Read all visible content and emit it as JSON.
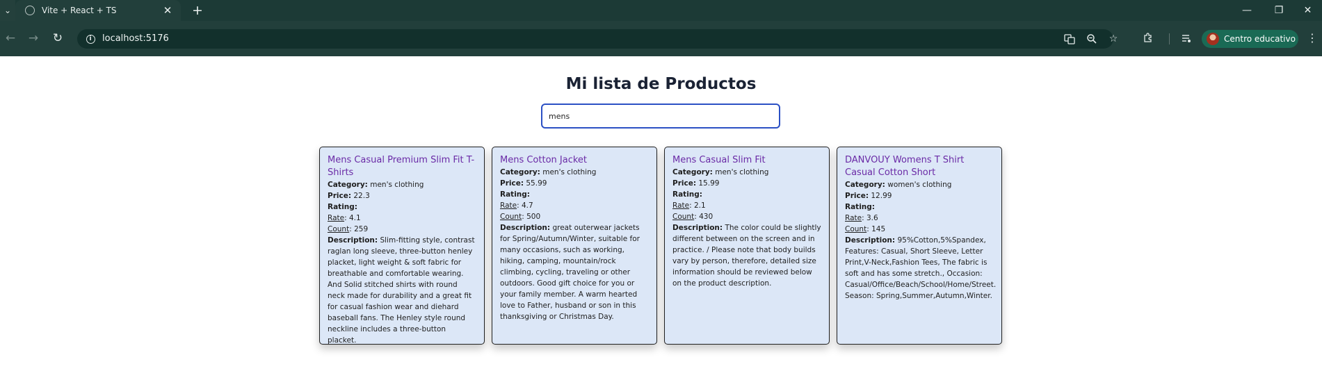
{
  "browser": {
    "tab_title": "Vite + React + TS",
    "tab_close": "✕",
    "new_tab": "+",
    "url": "localhost:5176",
    "profile_name": "Centro educativo",
    "window": {
      "minimize": "—",
      "restore": "❐",
      "close": "✕"
    }
  },
  "page": {
    "title": "Mi lista de Productos",
    "search_value": "mens"
  },
  "labels": {
    "category": "Category:",
    "price": "Price:",
    "rating": "Rating:",
    "rate": "Rate",
    "count": "Count",
    "description": "Description:"
  },
  "products": [
    {
      "title": "Mens Casual Premium Slim Fit T-Shirts",
      "category": "men's clothing",
      "price": "22.3",
      "rate": "4.1",
      "count": "259",
      "description": "Slim-fitting style, contrast raglan long sleeve, three-button henley placket, light weight & soft fabric for breathable and comfortable wearing. And Solid stitched shirts with round neck made for durability and a great fit for casual fashion wear and diehard baseball fans. The Henley style round neckline includes a three-button placket."
    },
    {
      "title": "Mens Cotton Jacket",
      "category": "men's clothing",
      "price": "55.99",
      "rate": "4.7",
      "count": "500",
      "description": "great outerwear jackets for Spring/Autumn/Winter, suitable for many occasions, such as working, hiking, camping, mountain/rock climbing, cycling, traveling or other outdoors. Good gift choice for you or your family member. A warm hearted love to Father, husband or son in this thanksgiving or Christmas Day."
    },
    {
      "title": "Mens Casual Slim Fit",
      "category": "men's clothing",
      "price": "15.99",
      "rate": "2.1",
      "count": "430",
      "description": "The color could be slightly different between on the screen and in practice. / Please note that body builds vary by person, therefore, detailed size information should be reviewed below on the product description."
    },
    {
      "title": "DANVOUY Womens T Shirt Casual Cotton Short",
      "category": "women's clothing",
      "price": "12.99",
      "rate": "3.6",
      "count": "145",
      "description": "95%Cotton,5%Spandex, Features: Casual, Short Sleeve, Letter Print,V-Neck,Fashion Tees, The fabric is soft and has some stretch., Occasion: Casual/Office/Beach/School/Home/Street. Season: Spring,Summer,Autumn,Winter."
    }
  ]
}
